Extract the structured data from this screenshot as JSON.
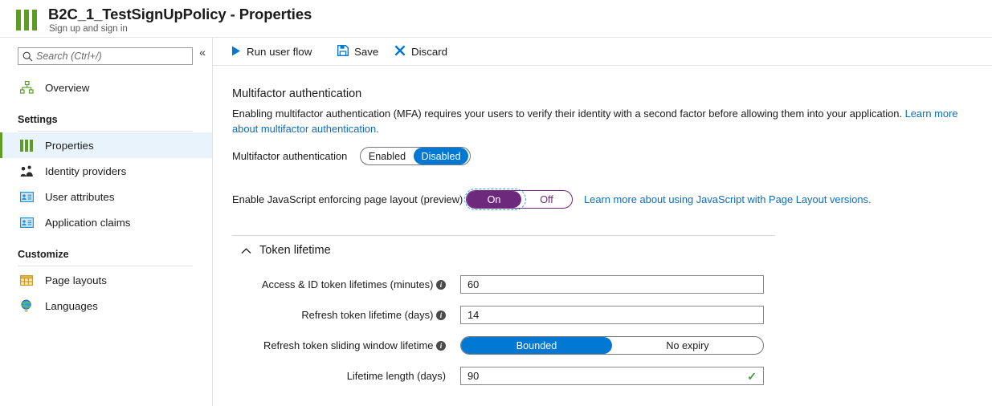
{
  "header": {
    "title": "B2C_1_TestSignUpPolicy - Properties",
    "subtitle": "Sign up and sign in",
    "icon": "policy-bars-icon"
  },
  "sidebar": {
    "search": {
      "placeholder": "Search (Ctrl+/)",
      "value": "",
      "icon": "search-icon"
    },
    "collapse": {
      "glyph": "«",
      "name": "collapse-sidebar-chevron-icon"
    },
    "overview": {
      "label": "Overview",
      "icon": "hierarchy-icon"
    },
    "groups": [
      {
        "label": "Settings",
        "items": [
          {
            "label": "Properties",
            "icon": "policy-bars-icon",
            "selected": true
          },
          {
            "label": "Identity providers",
            "icon": "identity-providers-icon",
            "selected": false
          },
          {
            "label": "User attributes",
            "icon": "user-attributes-icon",
            "selected": false
          },
          {
            "label": "Application claims",
            "icon": "application-claims-icon",
            "selected": false
          }
        ]
      },
      {
        "label": "Customize",
        "items": [
          {
            "label": "Page layouts",
            "icon": "page-layouts-icon",
            "selected": false
          },
          {
            "label": "Languages",
            "icon": "globe-icon",
            "selected": false
          }
        ]
      }
    ]
  },
  "toolbar": {
    "run_label": "Run user flow",
    "save_label": "Save",
    "discard_label": "Discard"
  },
  "main": {
    "mfa": {
      "heading": "Multifactor authentication",
      "description_part1": "Enabling multifactor authentication (MFA) requires your users to verify their identity with a second factor before allowing them into your application. ",
      "description_link": "Learn more about multifactor authentication.",
      "field_label": "Multifactor authentication",
      "options": [
        "Enabled",
        "Disabled"
      ],
      "selected": "Disabled"
    },
    "javascript": {
      "field_label": "Enable JavaScript enforcing page layout (preview)",
      "options": [
        "On",
        "Off"
      ],
      "selected": "On",
      "link": "Learn more about using JavaScript with Page Layout versions."
    },
    "token_lifetime": {
      "section_title": "Token lifetime",
      "expanded": true,
      "fields": [
        {
          "label": "Access & ID token lifetimes (minutes)",
          "info": true,
          "type": "text",
          "value": "60"
        },
        {
          "label": "Refresh token lifetime (days)",
          "info": true,
          "type": "text",
          "value": "14"
        },
        {
          "label": "Refresh token sliding window lifetime",
          "info": true,
          "type": "toggle",
          "options": [
            "Bounded",
            "No expiry"
          ],
          "selected": "Bounded"
        },
        {
          "label": "Lifetime length (days)",
          "info": false,
          "type": "text",
          "value": "90",
          "valid": true
        }
      ]
    }
  },
  "colors": {
    "accent_blue": "#0078d4",
    "link_blue": "#0f6cbd",
    "brand_green": "#5e9c26",
    "purple": "#6d2a7d",
    "valid_green": "#3f9c35",
    "selected_row": "#e9f3fb"
  }
}
